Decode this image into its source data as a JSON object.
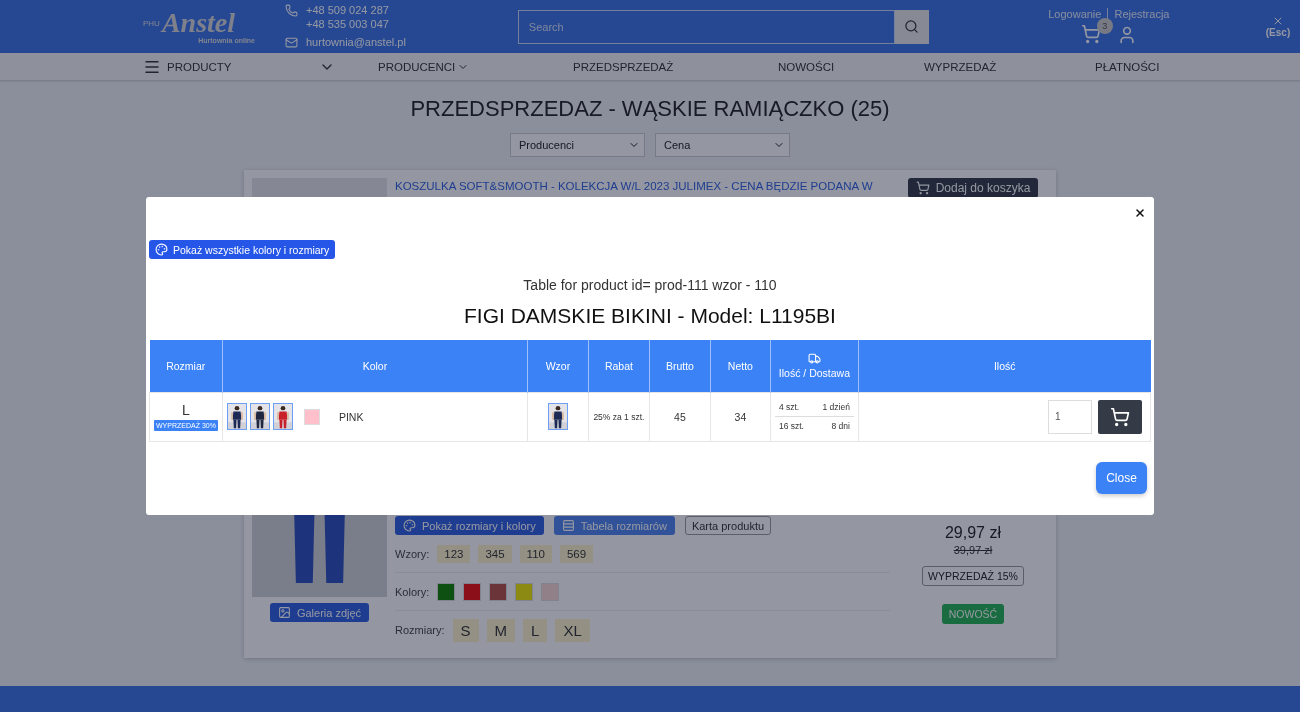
{
  "header": {
    "logo": {
      "prefix": "PHU",
      "brand": "Anstel",
      "tagline": "Hurtownia online"
    },
    "phones": [
      "+48 509 024 287",
      "+48 535 003 047"
    ],
    "email": "hurtownia@anstel.pl",
    "search": {
      "placeholder": "Search"
    },
    "account_links": [
      "Logowanie",
      "Rejestracja"
    ],
    "cart_count": "3",
    "close_hint": "(Esc)"
  },
  "nav": [
    {
      "label": "PRODUCTY",
      "kind": "menu"
    },
    {
      "label": "PRODUCENCI",
      "kind": "dropdown"
    },
    {
      "label": "PRZEDSPRZEDAŻ",
      "kind": "link"
    },
    {
      "label": "NOWOŚCI",
      "kind": "link"
    },
    {
      "label": "WYPRZEDAŻ",
      "kind": "link"
    },
    {
      "label": "PŁATNOŚCI",
      "kind": "link"
    }
  ],
  "page_title": "PRZEDSPRZEDAZ - WĄSKIE RAMIĄCZKO (25)",
  "filters": [
    "Producenci",
    "Cena"
  ],
  "product": {
    "title": "KOSZULKA SOFT&SMOOTH - KOLEKCJA W/L 2023 JULIMEX - CENA BĘDZIE PODANA W",
    "add_to_cart": "Dodaj do koszyka",
    "gallery": "Galeria zdjęć",
    "actions": [
      "Pokaż rozmiary i kolory",
      "Tabela rozmiarów",
      "Karta produktu"
    ],
    "patterns_label": "Wzory:",
    "patterns": [
      "123",
      "345",
      "110",
      "569"
    ],
    "colors_label": "Kolory:",
    "colors": [
      {
        "color": "#0f5010"
      },
      {
        "color": "#8a1018"
      },
      {
        "color": "#6a3438"
      },
      {
        "color": "#8c8a10"
      },
      {
        "color": "#928088"
      }
    ],
    "sizes_label": "Rozmiary:",
    "sizes": [
      "S",
      "M",
      "L",
      "XL"
    ],
    "price": "29,97 zł",
    "old_price": "39,97 zł",
    "sale_badge": "WYPRZEDAŻ 15%",
    "new_badge": "NOWOŚĆ"
  },
  "modal": {
    "show_all": "Pokaż wszystkie kolory i rozmiary",
    "subtitle": "Table for product id= prod-111 wzor - 110",
    "title": "FIGI DAMSKIE BIKINI - Model: L1195BI",
    "columns": [
      "Rozmiar",
      "Kolor",
      "Wzor",
      "Rabat",
      "Brutto",
      "Netto",
      "Ilość / Dostawa",
      "Ilość"
    ],
    "rows": [
      {
        "size": "L",
        "size_badge": "WYPRZEDAŻ 30%",
        "thumbnails": [
          {
            "kind": "picture"
          },
          {
            "kind": "picture"
          },
          {
            "kind": "picture"
          }
        ],
        "swatch": {
          "color": "#ffc0cb"
        },
        "color_name": "PINK",
        "pattern": {
          "kind": "picture"
        },
        "discount": "25% za 1 szt.",
        "gross": "45",
        "net": "34",
        "delivery": [
          {
            "qty": "4 szt.",
            "time": "1 dzień"
          },
          {
            "qty": "16 szt.",
            "time": "8 dni"
          }
        ],
        "quantity": "1"
      }
    ],
    "close": "Close"
  }
}
